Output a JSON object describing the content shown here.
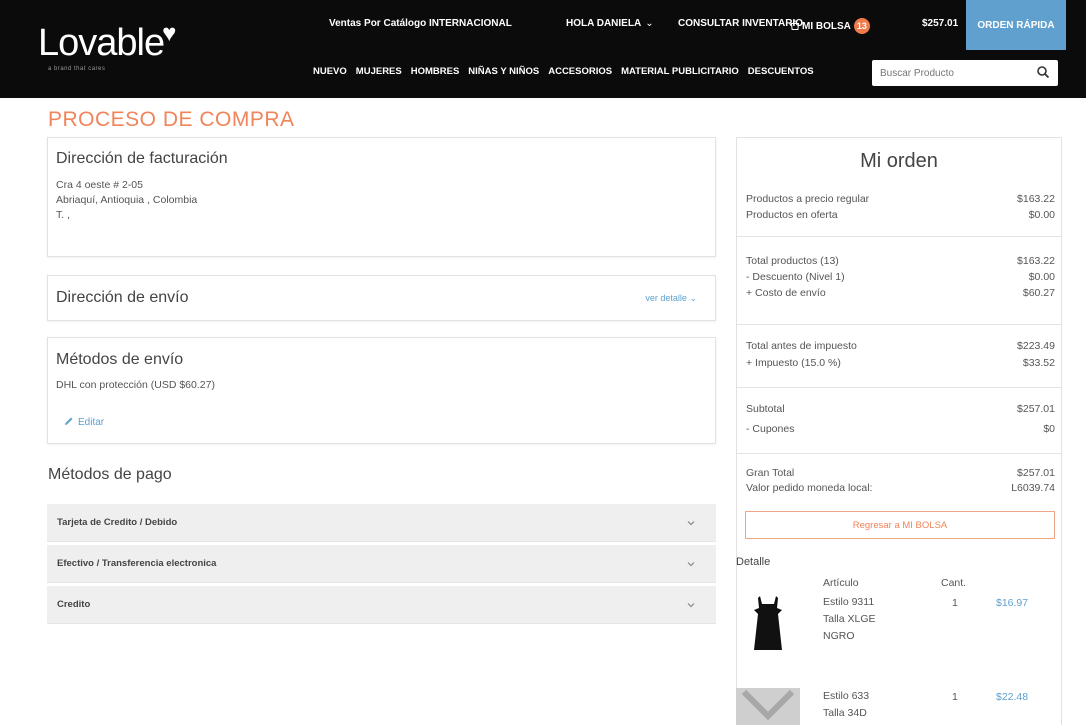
{
  "header": {
    "logo": "Lovable",
    "logo_tagline": "a brand that cares",
    "top_links": {
      "catalog": "Ventas Por Catálogo INTERNACIONAL",
      "greeting": "HOLA DANIELA",
      "inventory": "CONSULTAR INVENTARIO",
      "bag": "MI BOLSA",
      "bag_count": "13",
      "bag_total": "$257.01",
      "quick_order": "ORDEN RÁPIDA"
    },
    "nav": [
      "NUEVO",
      "MUJERES",
      "HOMBRES",
      "NIÑAS Y NIÑOS",
      "ACCESORIOS",
      "MATERIAL PUBLICITARIO",
      "DESCUENTOS"
    ],
    "search_placeholder": "Buscar Producto"
  },
  "page_title": "PROCESO DE COMPRA",
  "billing": {
    "title": "Dirección de facturación",
    "line1": "Cra 4 oeste # 2-05",
    "line2": "Abriaquí, Antioquia , Colombia",
    "line3": "T. ,"
  },
  "shipping_address": {
    "title": "Dirección de envío",
    "details_link": "ver detalle"
  },
  "shipping_method": {
    "title": "Métodos de envío",
    "value": "DHL con protección (USD $60.27)",
    "edit": "Editar"
  },
  "payment": {
    "title": "Métodos de pago",
    "options": [
      "Tarjeta de Credito / Debido",
      "Efectivo / Transferencia electronica",
      "Credito"
    ]
  },
  "order": {
    "title": "Mi orden",
    "regular_label": "Productos a precio regular",
    "regular_value": "$163.22",
    "sale_label": "Productos en oferta",
    "sale_value": "$0.00",
    "total_products_label": "Total productos (13)",
    "total_products_value": "$163.22",
    "discount_label": "- Descuento (Nivel 1)",
    "discount_value": "$0.00",
    "shipping_label": "+ Costo de envío",
    "shipping_value": "$60.27",
    "pretax_label": "Total antes de impuesto",
    "pretax_value": "$223.49",
    "tax_label": "+ Impuesto (15.0 %)",
    "tax_value": "$33.52",
    "subtotal_label": "Subtotal",
    "subtotal_value": "$257.01",
    "coupons_label": "- Cupones",
    "coupons_value": "$0",
    "grand_label": "Gran Total",
    "grand_value": "$257.01",
    "local_label": "Valor pedido moneda local:",
    "local_value": "L6039.74",
    "back_button": "Regresar a MI BOLSA",
    "detail_title": "Detalle",
    "col_article": "Artículo",
    "col_qty": "Cant.",
    "items": [
      {
        "style": "Estilo 9311",
        "size": "Talla XLGE",
        "color": "NGRO",
        "qty": "1",
        "price": "$16.97"
      },
      {
        "style": "Estilo 633",
        "size": "Talla 34D",
        "qty": "1",
        "price": "$22.48"
      }
    ]
  },
  "colors": {
    "accent": "#f0845a",
    "link": "#5fa0cf",
    "header_bg": "#0b0b0b"
  }
}
